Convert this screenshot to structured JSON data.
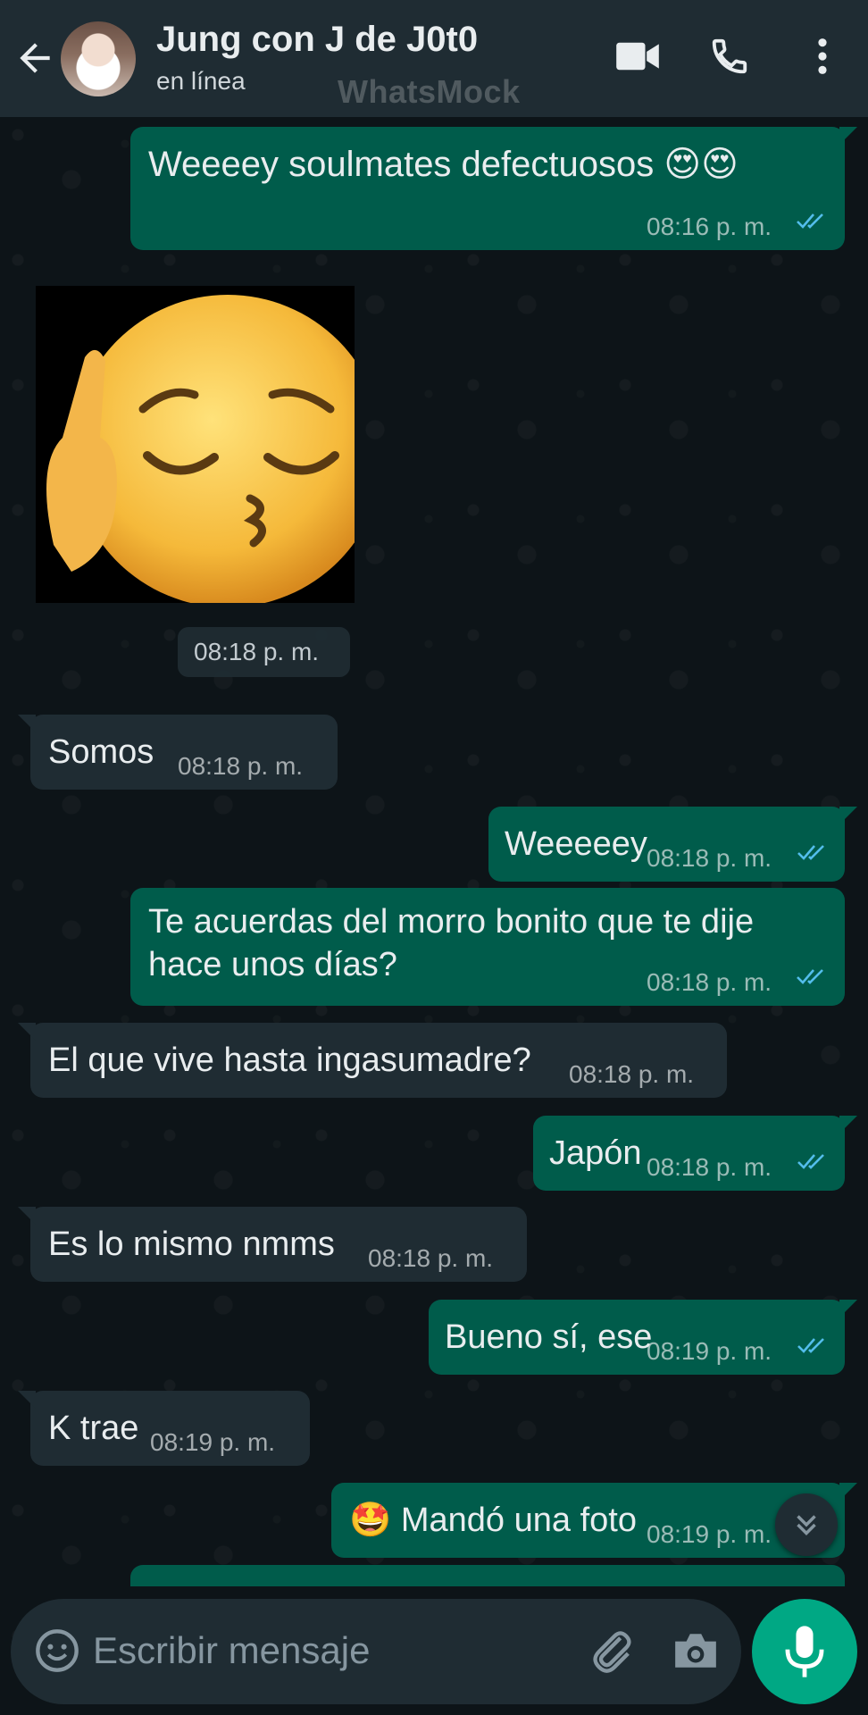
{
  "header": {
    "contact_name": "Jung con J de J0t0",
    "status": "en línea",
    "watermark": "WhatsMock"
  },
  "messages": [
    {
      "dir": "out",
      "text": "Weeeey soulmates defectuosos 😍😍",
      "time": "08:16 p. m.",
      "read": true
    },
    {
      "dir": "in",
      "type": "sticker",
      "sticker": "pensive-kiss-finger-emoji",
      "time": "08:18 p. m."
    },
    {
      "dir": "in",
      "text": "Somos",
      "time": "08:18 p. m."
    },
    {
      "dir": "out",
      "text": "Weeeeey",
      "time": "08:18 p. m.",
      "read": true
    },
    {
      "dir": "out",
      "text_lines": [
        "Te acuerdas del morro bonito que te dije",
        "hace unos días?"
      ],
      "time": "08:18 p. m.",
      "read": true
    },
    {
      "dir": "in",
      "text": "El que vive hasta ingasumadre?",
      "time": "08:18 p. m."
    },
    {
      "dir": "out",
      "text": "Japón",
      "time": "08:18 p. m.",
      "read": true
    },
    {
      "dir": "in",
      "text": "Es lo mismo nmms",
      "time": "08:18 p. m."
    },
    {
      "dir": "out",
      "text": "Bueno sí, ese",
      "time": "08:19 p. m.",
      "read": true
    },
    {
      "dir": "in",
      "text": "K trae",
      "time": "08:19 p. m."
    },
    {
      "dir": "out",
      "text": "🤩 Mandó una foto",
      "time": "08:19 p. m.",
      "read": true
    }
  ],
  "composer": {
    "placeholder": "Escribir mensaje"
  },
  "colors": {
    "header_bg": "#1f2c33",
    "outgoing_bubble": "#005c4b",
    "incoming_bubble": "#1f2c33",
    "read_ticks": "#53bdeb",
    "accent": "#00a884"
  },
  "icons": [
    "back-arrow-icon",
    "video-call-icon",
    "phone-icon",
    "more-vert-icon",
    "emoji-icon",
    "attach-icon",
    "camera-icon",
    "mic-icon",
    "chevron-double-down-icon",
    "double-check-icon"
  ]
}
